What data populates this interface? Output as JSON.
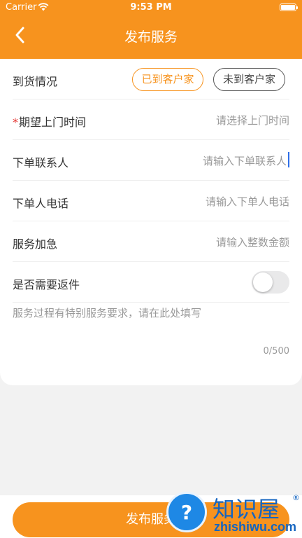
{
  "status_bar": {
    "carrier": "Carrier",
    "time": "9:53 PM"
  },
  "nav": {
    "title": "发布服务"
  },
  "form": {
    "arrival": {
      "label": "到货情况",
      "options": [
        "已到客户家",
        "未到客户家"
      ],
      "selected_index": 0
    },
    "visit_time": {
      "required_mark": "*",
      "label": "期望上门时间",
      "placeholder": "请选择上门时间"
    },
    "contact": {
      "label": "下单联系人",
      "placeholder": "请输入下单联系人"
    },
    "phone": {
      "label": "下单人电话",
      "placeholder": "请输入下单人电话"
    },
    "urgent": {
      "label": "服务加急",
      "placeholder": "请输入整数金额"
    },
    "return": {
      "label": "是否需要返件",
      "enabled": false
    },
    "remarks": {
      "placeholder": "服务过程有特别服务要求，请在此处填写",
      "counter": "0/500"
    }
  },
  "submit_button": {
    "label": "发布服务"
  },
  "watermark": {
    "text": "知识屋",
    "sub": "zhishiwu.com",
    "reg": "®"
  },
  "colors": {
    "accent": "#f7931e",
    "background": "#f2f2f2"
  }
}
